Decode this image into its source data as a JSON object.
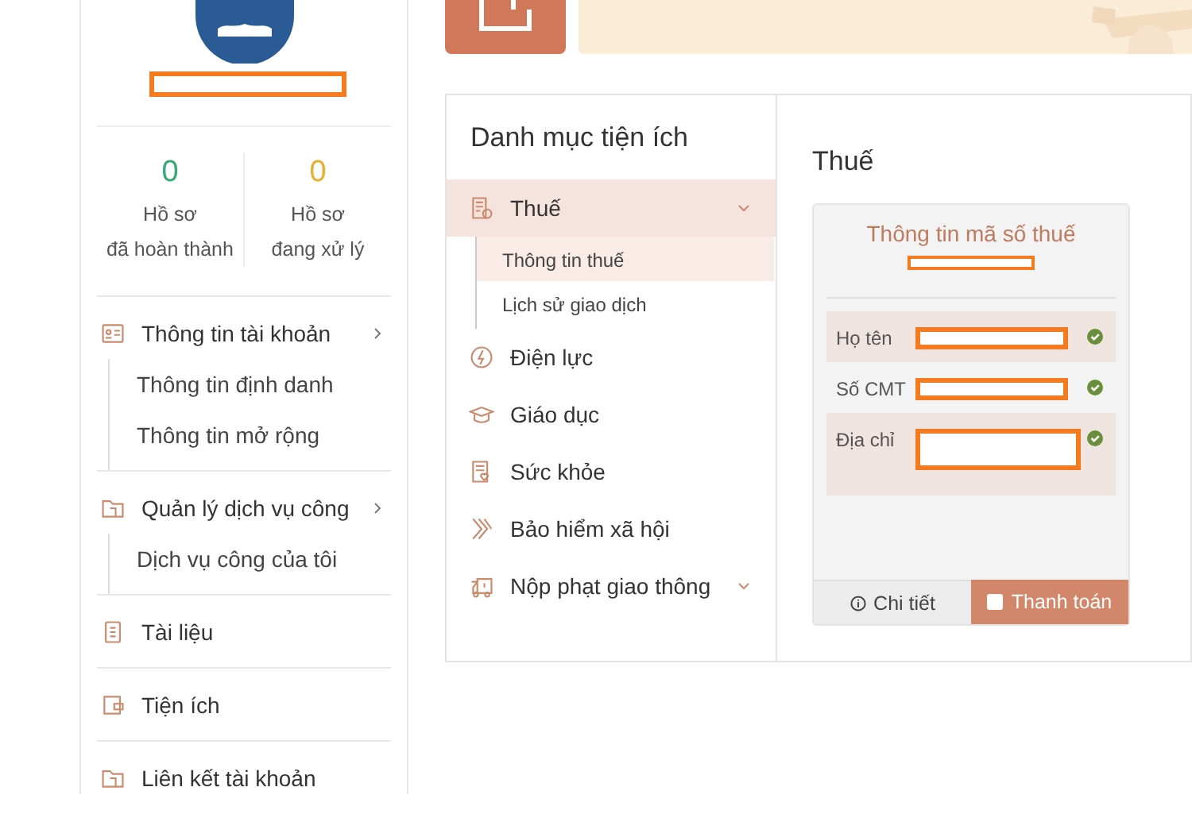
{
  "profile": {
    "stats": [
      {
        "count": "0",
        "line_1": "Hồ sơ",
        "line_2": "đã hoàn thành",
        "color": "#3aa876"
      },
      {
        "count": "0",
        "line_1": "Hồ sơ",
        "line_2": "đang xử lý",
        "color": "#e8b030"
      }
    ]
  },
  "sidebar": {
    "items": [
      {
        "label": "Thông tin tài khoản",
        "expandable": true,
        "children": [
          "Thông tin định danh",
          "Thông tin mở rộng"
        ]
      },
      {
        "label": "Quản lý dịch vụ công",
        "expandable": true,
        "children": [
          "Dịch vụ công của tôi"
        ]
      },
      {
        "label": "Tài liệu",
        "expandable": false
      },
      {
        "label": "Tiện ích",
        "expandable": false
      },
      {
        "label": "Liên kết tài khoản",
        "expandable": false
      }
    ]
  },
  "utility_menu": {
    "title": "Danh mục tiện ích",
    "items": [
      {
        "label": "Thuế",
        "selected": true,
        "expandable": true,
        "children": [
          {
            "label": "Thông tin thuế",
            "selected": true
          },
          {
            "label": "Lịch sử giao dịch",
            "selected": false
          }
        ]
      },
      {
        "label": "Điện lực",
        "selected": false,
        "expandable": false
      },
      {
        "label": "Giáo dục",
        "selected": false,
        "expandable": false
      },
      {
        "label": "Sức khỏe",
        "selected": false,
        "expandable": false
      },
      {
        "label": "Bảo hiểm xã hội",
        "selected": false,
        "expandable": false
      },
      {
        "label": "Nộp phạt giao thông",
        "selected": false,
        "expandable": true
      }
    ]
  },
  "detail": {
    "title": "Thuế",
    "card": {
      "title": "Thông tin mã số thuế",
      "fields": [
        {
          "label": "Họ tên",
          "verified": true
        },
        {
          "label": "Số CMT",
          "verified": true
        },
        {
          "label": "Địa chỉ",
          "verified": true
        }
      ],
      "buttons": [
        {
          "label": "Chi tiết",
          "kind": "secondary"
        },
        {
          "label": "Thanh toán",
          "kind": "primary"
        }
      ]
    }
  }
}
